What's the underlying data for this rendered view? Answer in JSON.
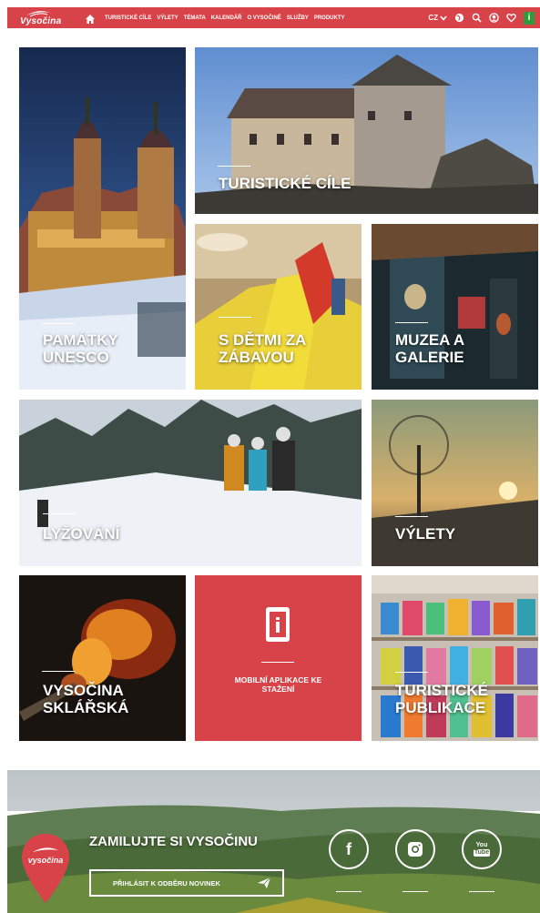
{
  "header": {
    "logo_text": "Vysočina",
    "nav": [
      "TURISTICKÉ CÍLE",
      "VÝLETY",
      "TÉMATA",
      "KALENDÁŘ",
      "O VYSOČINĚ",
      "SLUŽBY",
      "PRODUKTY"
    ],
    "lang": "CZ",
    "icons": [
      "home-icon",
      "globe-icon",
      "search-icon",
      "user-icon",
      "heart-icon",
      "info-icon"
    ],
    "info_glyph": "i",
    "colors": {
      "bar": "#d8434a",
      "info": "#2e9b3a"
    }
  },
  "tiles": {
    "unesco": "PAMÁTKY UNESCO",
    "turisticke_cile": "TURISTICKÉ CÍLE",
    "s_detmi": "S DĚTMI ZA ZÁBAVOU",
    "muzea": "MUZEA A GALERIE",
    "lyzovani": "LYŽOVÁNÍ",
    "vylety": "VÝLETY",
    "sklarska": "VYSOČINA SKLÁŘSKÁ",
    "mobilni": "MOBILNÍ APLIKACE KE STAŽENÍ",
    "mobilni_icon": "phone-info-icon",
    "publikace": "TURISTICKÉ PUBLIKACE"
  },
  "promo": {
    "title": "ZAMILUJTE SI VYSOČINU",
    "button": "PŘIHLÁSIT K ODBĚRU NOVINEK",
    "pin_text": "vysočina",
    "social": [
      "facebook-icon",
      "instagram-icon",
      "youtube-icon"
    ],
    "social_glyphs": {
      "facebook": "f",
      "youtube_top": "You",
      "youtube_bottom": "Tube"
    }
  }
}
